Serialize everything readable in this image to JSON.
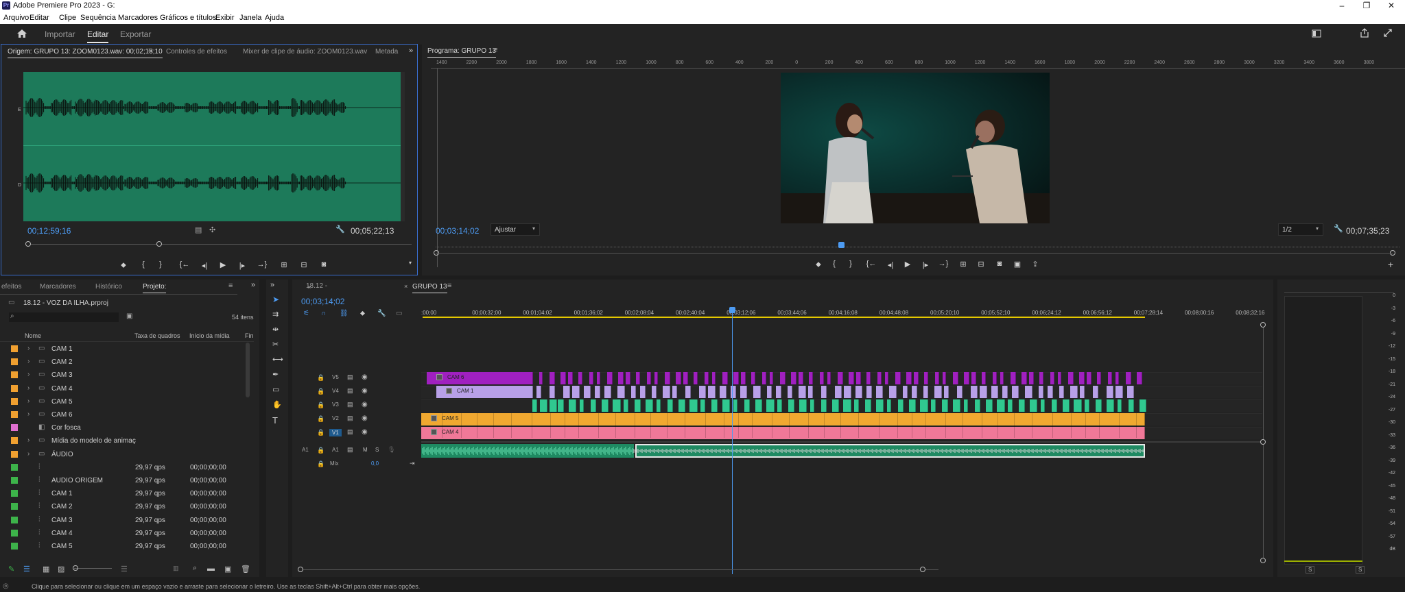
{
  "window": {
    "title": "Adobe Premiere Pro 2023 - G:",
    "logo_text": "Pr",
    "minimize_glyph": "–",
    "restore_glyph": "❐",
    "close_glyph": "✕"
  },
  "menu": [
    "Arquivo",
    "Editar",
    "Clipe",
    "Sequência",
    "Marcadores",
    "Gráficos e títulos",
    "Exibir",
    "Janela",
    "Ajuda"
  ],
  "workspace_tabs": [
    "Importar",
    "Editar",
    "Exportar"
  ],
  "source_monitor": {
    "tabs": [
      "Origem: GRUPO 13: ZOOM0123.wav: 00;02;13;10",
      "Controles de efeitos",
      "Mixer de clipe de áudio: ZOOM0123.wav",
      "Metada"
    ],
    "channel_labels": [
      "E",
      "D"
    ],
    "timecode_current": "00;12;59;16",
    "timecode_duration": "00;05;22;13",
    "waveform_color": "#1d7a5a"
  },
  "program_monitor": {
    "tab": "Programa: GRUPO 13",
    "ruler_labels": [
      "1400",
      "2200",
      "2000",
      "1800",
      "1600",
      "1400",
      "1200",
      "1000",
      "800",
      "600",
      "400",
      "200",
      "0",
      "200",
      "400",
      "600",
      "800",
      "1000",
      "1200",
      "1400",
      "1600",
      "1800",
      "2000",
      "2200",
      "2400",
      "2600",
      "2800",
      "3000",
      "3200",
      "3400",
      "3600",
      "3800"
    ],
    "timecode_current": "00;03;14;02",
    "fit_label": "Ajustar",
    "resolution_label": "1/2",
    "timecode_duration": "00;07;35;23"
  },
  "project_panel": {
    "tabs": [
      "efeitos",
      "Marcadores",
      "Histórico",
      "Projeto:"
    ],
    "project_name": "18.12 - VOZ DA ILHA.prproj",
    "item_count": "54 itens",
    "columns": [
      "Nome",
      "Taxa de quadros",
      "Início da mídia",
      "Fin"
    ],
    "items": [
      {
        "name": "CAM 1",
        "type": "bin",
        "color": "#f0a030",
        "fps": "",
        "start": ""
      },
      {
        "name": "CAM 2",
        "type": "bin",
        "color": "#f0a030",
        "fps": "",
        "start": ""
      },
      {
        "name": "CAM 3",
        "type": "bin",
        "color": "#f0a030",
        "fps": "",
        "start": ""
      },
      {
        "name": "CAM 4",
        "type": "bin",
        "color": "#f0a030",
        "fps": "",
        "start": ""
      },
      {
        "name": "CAM 5",
        "type": "bin",
        "color": "#f0a030",
        "fps": "",
        "start": ""
      },
      {
        "name": "CAM 6",
        "type": "bin",
        "color": "#f0a030",
        "fps": "",
        "start": ""
      },
      {
        "name": "Cor fosca",
        "type": "matte",
        "color": "#e070d0",
        "fps": "",
        "start": ""
      },
      {
        "name": "Mídia do modelo de animaç",
        "type": "bin",
        "color": "#f0a030",
        "fps": "",
        "start": ""
      },
      {
        "name": "ÁUDIO",
        "type": "bin",
        "color": "#f0a030",
        "fps": "",
        "start": ""
      },
      {
        "name": "",
        "type": "seq",
        "color": "#3db34a",
        "fps": "29,97 qps",
        "start": "00;00;00;00"
      },
      {
        "name": "AUDIO ORIGEM",
        "type": "seq",
        "color": "#3db34a",
        "fps": "29,97 qps",
        "start": "00;00;00;00"
      },
      {
        "name": "CAM 1",
        "type": "seq",
        "color": "#3db34a",
        "fps": "29,97 qps",
        "start": "00;00;00;00"
      },
      {
        "name": "CAM 2",
        "type": "seq",
        "color": "#3db34a",
        "fps": "29,97 qps",
        "start": "00;00;00;00"
      },
      {
        "name": "CAM 3",
        "type": "seq",
        "color": "#3db34a",
        "fps": "29,97 qps",
        "start": "00;00;00;00"
      },
      {
        "name": "CAM 4",
        "type": "seq",
        "color": "#3db34a",
        "fps": "29,97 qps",
        "start": "00;00;00;00"
      },
      {
        "name": "CAM 5",
        "type": "seq",
        "color": "#3db34a",
        "fps": "29,97 qps",
        "start": "00;00;00;00"
      }
    ]
  },
  "timeline": {
    "tab_prev": "18.12 -",
    "tab_active": "GRUPO 13",
    "timecode": "00;03;14;02",
    "ruler_labels": [
      ":00;00",
      "00;00;32;00",
      "00;01;04;02",
      "00;01;36;02",
      "00;02;08;04",
      "00;02;40;04",
      "00;03;12;06",
      "00;03;44;06",
      "00;04;16;08",
      "00;04;48;08",
      "00;05;20;10",
      "00;05;52;10",
      "00;06;24;12",
      "00;06;56;12",
      "00;07;28;14",
      "00;08;00;16",
      "00;08;32;16"
    ],
    "playhead_fraction": 0.365,
    "video_tracks": [
      {
        "name": "V5",
        "clip_label": "CAM 6",
        "color": "#a020c0"
      },
      {
        "name": "V4",
        "clip_label": "CAM 1",
        "color": "#b8a0e8"
      },
      {
        "name": "V3",
        "clip_label": "",
        "color": "#30c890"
      },
      {
        "name": "V2",
        "clip_label": "CAM 5",
        "color": "#f0a830"
      },
      {
        "name": "V1",
        "clip_label": "CAM 4",
        "color": "#f07898"
      }
    ],
    "audio_tracks": [
      {
        "name": "A1",
        "source": "A1",
        "mute": "M",
        "solo": "S"
      }
    ],
    "mix_label": "Mix",
    "mix_value": "0,0"
  },
  "meters": {
    "labels": [
      "0",
      "-3",
      "-6",
      "-9",
      "-12",
      "-15",
      "-18",
      "-21",
      "-24",
      "-27",
      "-30",
      "-33",
      "-36",
      "-39",
      "-42",
      "-45",
      "-48",
      "-51",
      "-54",
      "-57",
      "dB"
    ],
    "solo_labels": [
      "S",
      "S"
    ]
  },
  "status_bar": {
    "text": "Clique para selecionar ou clique em um espaço vazio e arraste para selecionar o letreiro. Use as teclas Shift+Alt+Ctrl para obter mais opções."
  }
}
